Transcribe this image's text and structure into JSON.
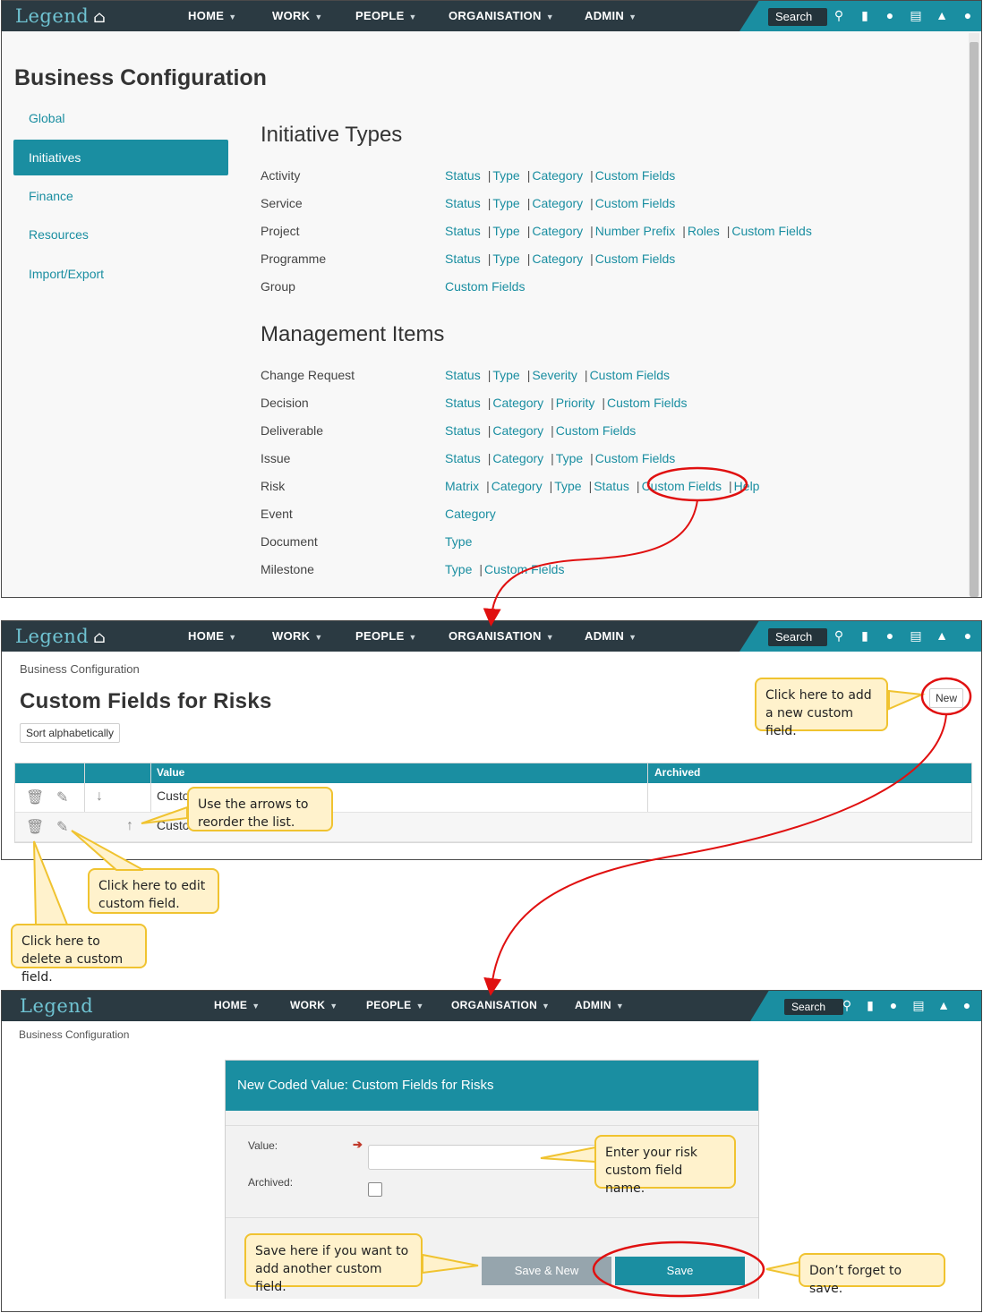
{
  "navbar": {
    "logo": "Legend",
    "items": [
      "HOME",
      "WORK",
      "PEOPLE",
      "ORGANISATION",
      "ADMIN"
    ],
    "search_label": "Search",
    "icons": [
      "search-icon",
      "bookmark-icon",
      "chat-icon",
      "document-icon",
      "bell-icon",
      "user-icon"
    ]
  },
  "screen1": {
    "title": "Business Configuration",
    "left_nav": [
      "Global",
      "Initiatives",
      "Finance",
      "Resources",
      "Import/Export"
    ],
    "active_nav": "Initiatives",
    "initiative_types": {
      "heading": "Initiative Types",
      "rows": [
        {
          "label": "Activity",
          "links": [
            "Status",
            "Type",
            "Category",
            "Custom Fields"
          ]
        },
        {
          "label": "Service",
          "links": [
            "Status",
            "Type",
            "Category",
            "Custom Fields"
          ]
        },
        {
          "label": "Project",
          "links": [
            "Status",
            "Type",
            "Category",
            "Number Prefix",
            "Roles",
            "Custom Fields"
          ]
        },
        {
          "label": "Programme",
          "links": [
            "Status",
            "Type",
            "Category",
            "Custom Fields"
          ]
        },
        {
          "label": "Group",
          "links": [
            "Custom Fields"
          ]
        }
      ]
    },
    "management_items": {
      "heading": "Management Items",
      "rows": [
        {
          "label": "Change Request",
          "links": [
            "Status",
            "Type",
            "Severity",
            "Custom Fields"
          ]
        },
        {
          "label": "Decision",
          "links": [
            "Status",
            "Category",
            "Priority",
            "Custom Fields"
          ]
        },
        {
          "label": "Deliverable",
          "links": [
            "Status",
            "Category",
            "Custom Fields"
          ]
        },
        {
          "label": "Issue",
          "links": [
            "Status",
            "Category",
            "Type",
            "Custom Fields"
          ]
        },
        {
          "label": "Risk",
          "links": [
            "Matrix",
            "Category",
            "Type",
            "Status",
            "Custom Fields",
            "Help"
          ]
        },
        {
          "label": "Event",
          "links": [
            "Category"
          ]
        },
        {
          "label": "Document",
          "links": [
            "Type"
          ]
        },
        {
          "label": "Milestone",
          "links": [
            "Type",
            "Custom Fields"
          ]
        }
      ]
    }
  },
  "screen2": {
    "breadcrumb": "Business Configuration",
    "title": "Custom Fields for Risks",
    "sort_button": "Sort alphabetically",
    "new_button": "New",
    "columns": {
      "value": "Value",
      "archived": "Archived"
    },
    "row1_value": "Custo",
    "row2_value": "Custo"
  },
  "screen3": {
    "breadcrumb": "Business Configuration",
    "dialog_title": "New Coded Value: Custom Fields for Risks",
    "value_label": "Value:",
    "archived_label": "Archived:",
    "save_new_button": "Save & New",
    "save_button": "Save"
  },
  "callouts": {
    "new": "Click here to add a new custom field.",
    "arrows": "Use the arrows to reorder the list.",
    "edit": "Click here to edit custom field.",
    "delete": "Click here to delete a custom field.",
    "enter": "Enter your risk custom field name.",
    "save_new": "Save here if you want to add another custom field.",
    "save": "Don’t forget to save."
  },
  "colors": {
    "teal": "#1a8ea1",
    "navbar": "#2b3a42",
    "callout_fill": "#fff2cc",
    "callout_border": "#f0c330",
    "highlight": "#e01010"
  }
}
